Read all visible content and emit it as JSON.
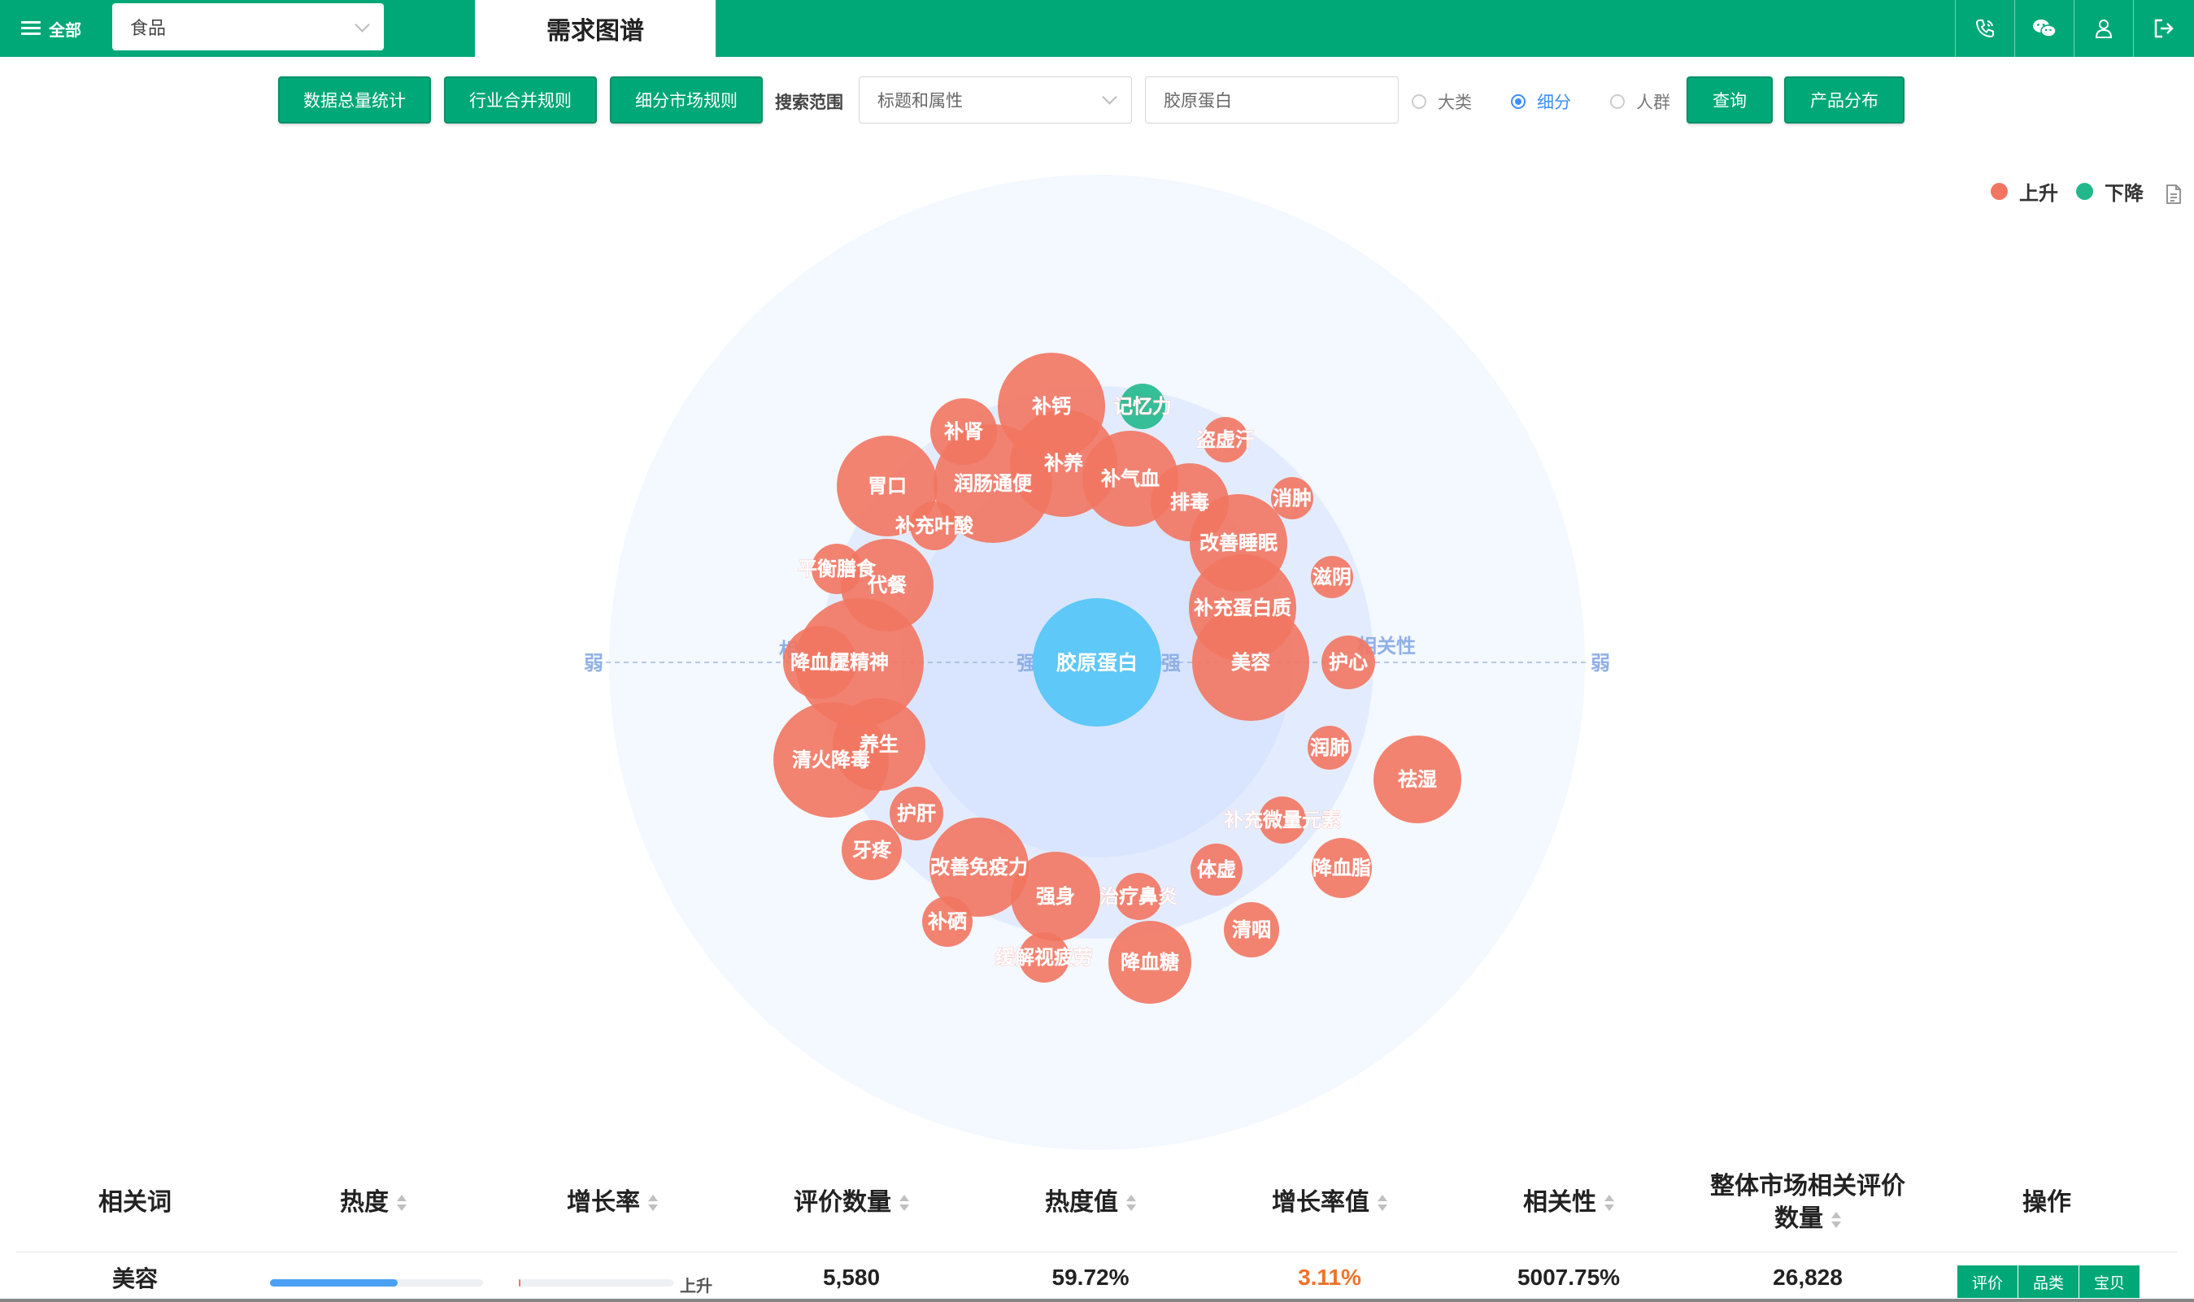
{
  "topbar": {
    "menu_label": "全部",
    "category_value": "食品",
    "page_tab": "需求图谱",
    "icons": [
      "phone-icon",
      "wechat-icon",
      "user-icon",
      "logout-icon"
    ]
  },
  "toolbar": {
    "btn_total": "数据总量统计",
    "btn_industry": "行业合并规则",
    "btn_segment": "细分市场规则",
    "search_label": "搜索范围",
    "scope_value": "标题和属性",
    "keyword_value": "胶原蛋白",
    "radio_major": "大类",
    "radio_segment": "细分",
    "radio_crowd": "人群",
    "selected_radio": "细分",
    "btn_query": "查询",
    "btn_product": "产品分布"
  },
  "legend": {
    "up": "上升",
    "down": "下降",
    "up_color": "#f27561",
    "down_color": "#21b98c"
  },
  "chart_data": {
    "type": "bubble",
    "center": "胶原蛋白",
    "axis_labels": {
      "left": "弱",
      "right": "弱",
      "inner_left": "强",
      "inner_right": "强",
      "partial_left": "相",
      "relevance": "相关性"
    },
    "colors": {
      "up": "#f27561",
      "down": "#21b98c",
      "center": "#5ec8f8"
    },
    "bubbles": [
      {
        "label": "补钙",
        "trend": "上升"
      },
      {
        "label": "记忆力",
        "trend": "下降"
      },
      {
        "label": "补肾",
        "trend": "上升"
      },
      {
        "label": "盗虚汗",
        "trend": "上升"
      },
      {
        "label": "补养",
        "trend": "上升"
      },
      {
        "label": "补气血",
        "trend": "上升"
      },
      {
        "label": "胃口",
        "trend": "上升"
      },
      {
        "label": "润肠通便",
        "trend": "上升"
      },
      {
        "label": "消肿",
        "trend": "上升"
      },
      {
        "label": "排毒",
        "trend": "上升"
      },
      {
        "label": "补充叶酸",
        "trend": "上升"
      },
      {
        "label": "改善睡眠",
        "trend": "上升"
      },
      {
        "label": "平衡膳食",
        "trend": "上升"
      },
      {
        "label": "代餐",
        "trend": "上升"
      },
      {
        "label": "滋阴",
        "trend": "上升"
      },
      {
        "label": "补充蛋白质",
        "trend": "上升"
      },
      {
        "label": "提精神",
        "trend": "上升"
      },
      {
        "label": "降血压",
        "trend": "上升"
      },
      {
        "label": "美容",
        "trend": "上升"
      },
      {
        "label": "护心",
        "trend": "上升"
      },
      {
        "label": "清火降毒",
        "trend": "上升"
      },
      {
        "label": "养生",
        "trend": "上升"
      },
      {
        "label": "润肺",
        "trend": "上升"
      },
      {
        "label": "祛湿",
        "trend": "上升"
      },
      {
        "label": "护肝",
        "trend": "上升"
      },
      {
        "label": "补充微量元素",
        "trend": "上升"
      },
      {
        "label": "牙疼",
        "trend": "上升"
      },
      {
        "label": "改善免疫力",
        "trend": "上升"
      },
      {
        "label": "体虚",
        "trend": "上升"
      },
      {
        "label": "降血脂",
        "trend": "上升"
      },
      {
        "label": "强身",
        "trend": "上升"
      },
      {
        "label": "治疗鼻炎",
        "trend": "上升"
      },
      {
        "label": "补硒",
        "trend": "上升"
      },
      {
        "label": "清咽",
        "trend": "上升"
      },
      {
        "label": "缓解视疲劳",
        "trend": "上升"
      },
      {
        "label": "降血糖",
        "trend": "上升"
      }
    ]
  },
  "table": {
    "headers": {
      "word": "相关词",
      "heat": "热度",
      "growth": "增长率",
      "reviews": "评价数量",
      "heat_value": "热度值",
      "growth_value": "增长率值",
      "relevance": "相关性",
      "market_reviews_1": "整体市场相关评价",
      "market_reviews_2": "数量",
      "ops": "操作"
    },
    "rows": [
      {
        "word": "美容",
        "heat_fraction": 0.6,
        "growth_fraction": 0.01,
        "growth_trend": "上升",
        "reviews": "5,580",
        "heat_value": "59.72%",
        "growth_value": "3.11%",
        "relevance": "5007.75%",
        "market_reviews": "26,828",
        "op_reviews": "评价",
        "op_category": "品类",
        "op_items": "宝贝"
      }
    ]
  }
}
